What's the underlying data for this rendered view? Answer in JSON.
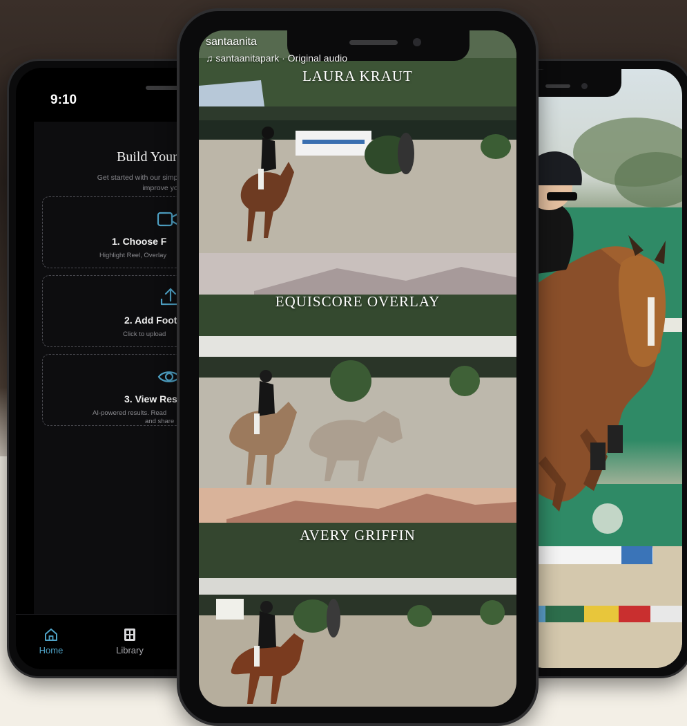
{
  "left_phone": {
    "status_time": "9:10",
    "app": {
      "title": "Build Your",
      "subtitle_line1": "Get started with our simple three-s",
      "subtitle_line2": "improve your riding",
      "steps": [
        {
          "icon": "video-camera-icon",
          "title": "1. Choose F",
          "desc_line1": "Highlight Reel, Overlay",
          "desc_line2": ""
        },
        {
          "icon": "upload-icon",
          "title": "2. Add Foot",
          "desc_line1": "Click to upload",
          "desc_line2": ""
        },
        {
          "icon": "eye-icon",
          "title": "3. View Res",
          "desc_line1": "AI-powered results. Read",
          "desc_line2": "and share"
        }
      ]
    },
    "tabs": [
      {
        "label": "Home",
        "icon": "home-icon",
        "active": true
      },
      {
        "label": "Library",
        "icon": "library-icon",
        "active": false
      }
    ],
    "accent_color": "#4fa3c7"
  },
  "center_phone": {
    "username": "santaanita",
    "audio": "santaanitapark · Original audio",
    "panels": [
      {
        "label": "LAURA KRAUT"
      },
      {
        "label": "EQUISCORE OVERLAY"
      },
      {
        "label": "AVERY GRIFFIN"
      }
    ]
  }
}
